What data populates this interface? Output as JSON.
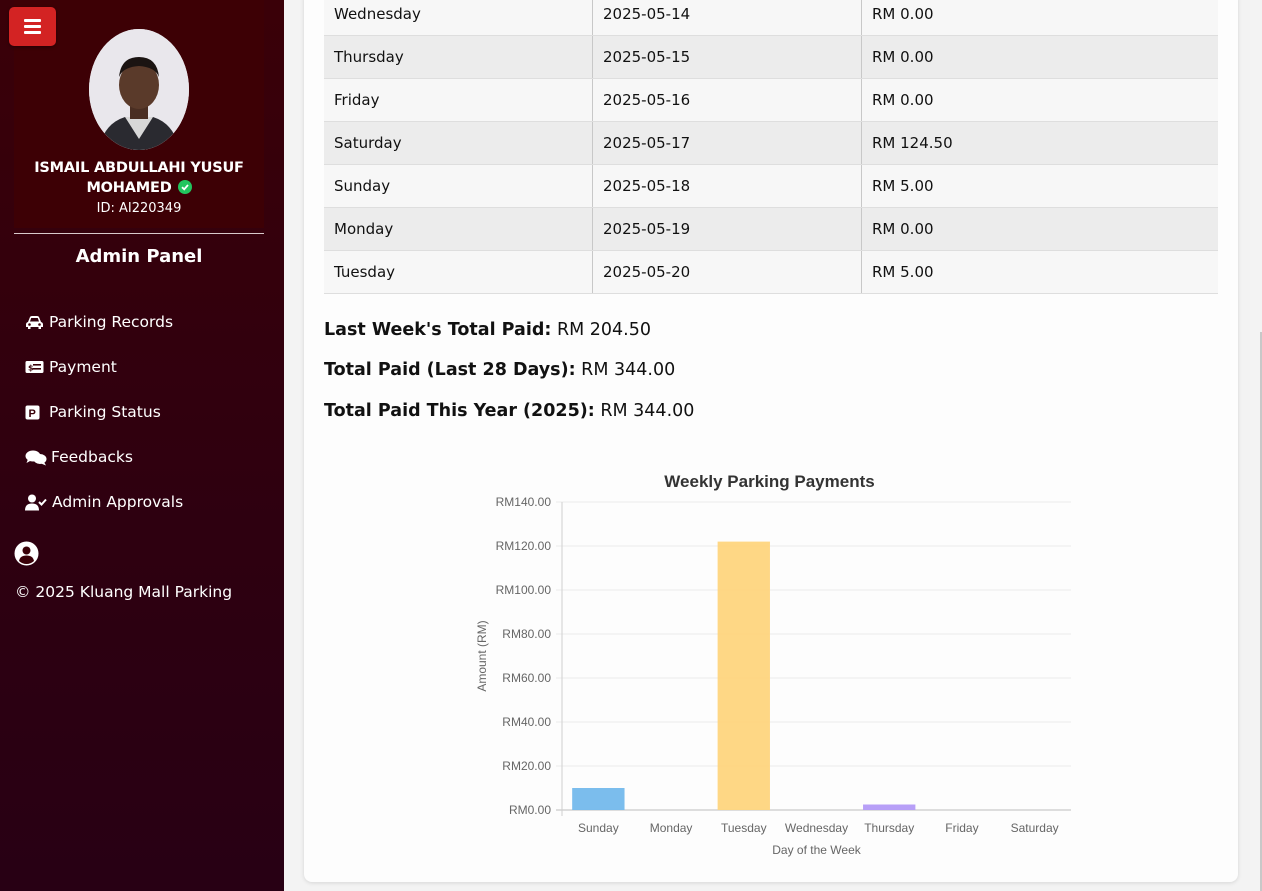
{
  "sidebar": {
    "user_name_line1": "ISMAIL ABDULLAHI YUSUF",
    "user_name_line2": "MOHAMED",
    "user_id": "ID: AI220349",
    "panel_title": "Admin Panel",
    "nav": [
      {
        "label": "Parking Records",
        "icon": "car-icon"
      },
      {
        "label": "Payment",
        "icon": "money-bill-icon"
      },
      {
        "label": "Parking Status",
        "icon": "parking-icon"
      },
      {
        "label": "Feedbacks",
        "icon": "comments-icon"
      },
      {
        "label": "Admin Approvals",
        "icon": "user-check-icon"
      }
    ],
    "copyright": "© 2025 Kluang Mall Parking",
    "colors": {
      "menu_button": "#d32323",
      "background": "#3a0008",
      "verified": "#22c55e"
    }
  },
  "records": [
    {
      "day": "Wednesday",
      "date": "2025-05-14",
      "amount": "RM 0.00"
    },
    {
      "day": "Thursday",
      "date": "2025-05-15",
      "amount": "RM 0.00"
    },
    {
      "day": "Friday",
      "date": "2025-05-16",
      "amount": "RM 0.00"
    },
    {
      "day": "Saturday",
      "date": "2025-05-17",
      "amount": "RM 124.50"
    },
    {
      "day": "Sunday",
      "date": "2025-05-18",
      "amount": "RM 5.00"
    },
    {
      "day": "Monday",
      "date": "2025-05-19",
      "amount": "RM 0.00"
    },
    {
      "day": "Tuesday",
      "date": "2025-05-20",
      "amount": "RM 5.00"
    }
  ],
  "summary": {
    "last_week_label": "Last Week's Total Paid:",
    "last_week_value": "RM 204.50",
    "last28_label": "Total Paid (Last 28 Days):",
    "last28_value": "RM 344.00",
    "year_label": "Total Paid This Year (2025):",
    "year_value": "RM 344.00"
  },
  "chart_data": {
    "type": "bar",
    "title": "Weekly Parking Payments",
    "xlabel": "Day of the Week",
    "ylabel": "Amount (RM)",
    "categories": [
      "Sunday",
      "Monday",
      "Tuesday",
      "Wednesday",
      "Thursday",
      "Friday",
      "Saturday"
    ],
    "values": [
      10,
      0,
      122,
      0,
      2.5,
      0,
      0
    ],
    "colors": [
      "#74b9ec",
      "#f29aaf",
      "#fed57e",
      "#7cc9c9",
      "#b39af7",
      "#fdb47a",
      "#c9cbcf"
    ],
    "ylim": [
      0,
      140
    ],
    "yticks": [
      0,
      20,
      40,
      60,
      80,
      100,
      120,
      140
    ],
    "ytick_labels": [
      "RM0.00",
      "RM20.00",
      "RM40.00",
      "RM60.00",
      "RM80.00",
      "RM100.00",
      "RM120.00",
      "RM140.00"
    ],
    "grid": true,
    "legend": "none"
  }
}
